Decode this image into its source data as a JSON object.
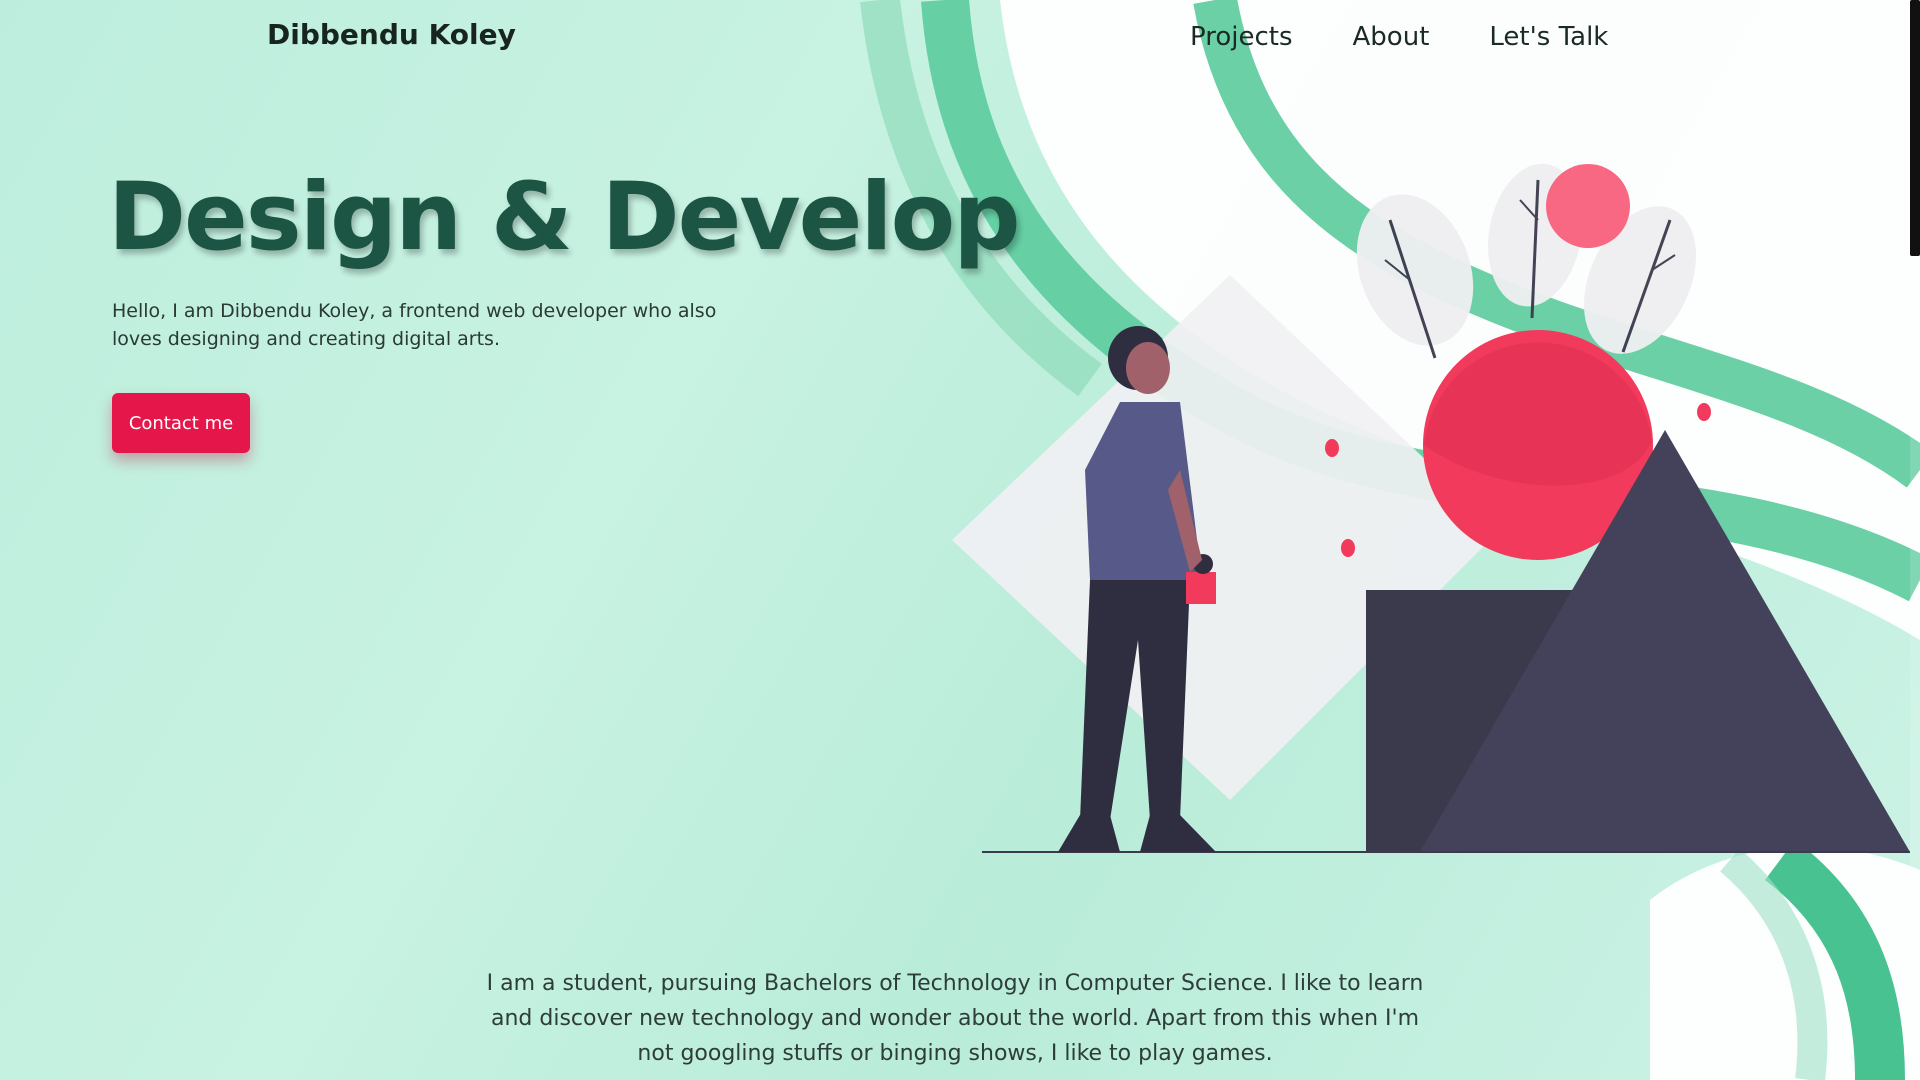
{
  "header": {
    "brand": "Dibbendu Koley",
    "nav": [
      {
        "label": "Projects"
      },
      {
        "label": "About"
      },
      {
        "label": "Let's Talk"
      }
    ]
  },
  "hero": {
    "title": "Design & Develop",
    "subtitle": "Hello, I am Dibbendu Koley, a frontend web developer who also loves designing and creating digital arts.",
    "cta_label": "Contact me"
  },
  "about": {
    "text": "I am a student, pursuing Bachelors of Technology in Computer Science. I like to learn and discover new technology and wonder about the world. Apart from this when I'm not googling stuffs or binging shows, I like to play games."
  },
  "colors": {
    "background": "#bfeedd",
    "accent_green": "#3dbf8c",
    "title": "#1d5545",
    "cta": "#e5164a",
    "dark_shape": "#3b3a4d",
    "red_sphere": "#f23a5c"
  },
  "illustration": {
    "name": "person-with-shapes-illustration"
  }
}
